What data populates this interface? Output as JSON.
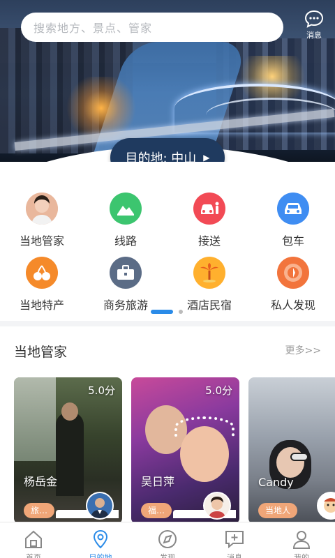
{
  "search": {
    "placeholder": "搜索地方、景点、管家"
  },
  "message": {
    "label": "消息"
  },
  "destination": {
    "label": "目的地: 中山"
  },
  "menu": {
    "items": [
      {
        "label": "当地管家"
      },
      {
        "label": "线路"
      },
      {
        "label": "接送"
      },
      {
        "label": "包车"
      },
      {
        "label": "当地特产"
      },
      {
        "label": "商务旅游"
      },
      {
        "label": "酒店民宿"
      },
      {
        "label": "私人发现"
      }
    ],
    "colors": {
      "route": "#3cc56f",
      "transfer": "#f24a55",
      "charter": "#3f8df2",
      "specialty": "#f58a2a",
      "business": "#5b6c86",
      "hotel": "#ffb02e",
      "discover": "#f2743c"
    }
  },
  "section": {
    "title": "当地管家",
    "more": "更多>>"
  },
  "cards": [
    {
      "name": "杨岳金",
      "score": "5.0分",
      "tag": "旅…"
    },
    {
      "name": "吴日萍",
      "score": "5.0分",
      "tag": "福…"
    },
    {
      "name": "Candy",
      "score": "",
      "tag": "当地人"
    }
  ],
  "tabs": [
    {
      "label": "首页",
      "icon": "home-icon"
    },
    {
      "label": "目的地",
      "icon": "location-icon"
    },
    {
      "label": "发现",
      "icon": "compass-icon"
    },
    {
      "label": "消息",
      "icon": "chat-plus-icon"
    },
    {
      "label": "我的",
      "icon": "user-icon"
    }
  ],
  "accent": "#2a8be8"
}
